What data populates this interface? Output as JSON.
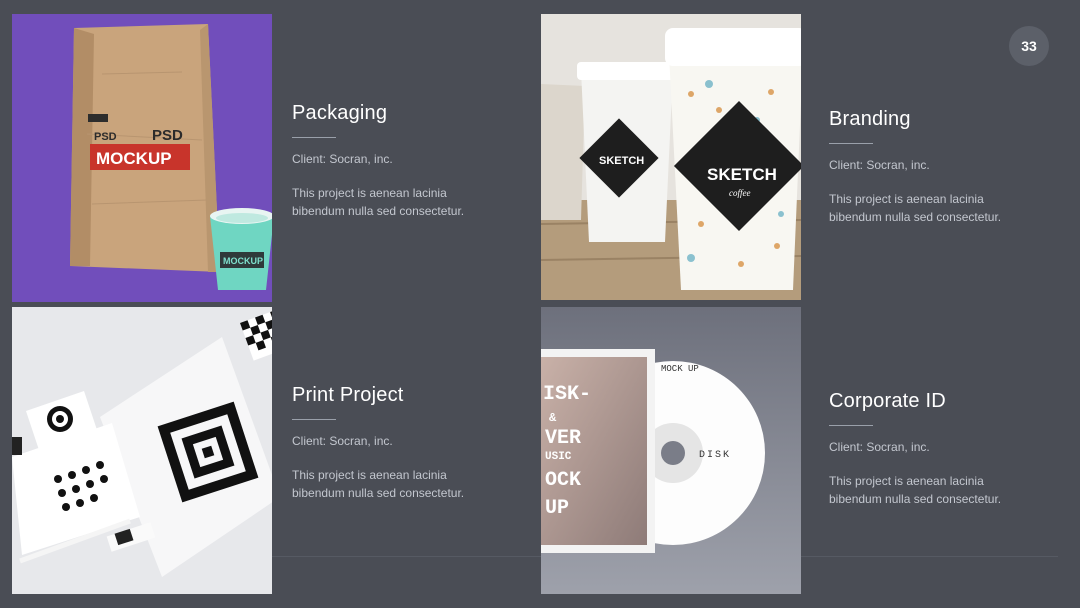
{
  "page_number": "33",
  "projects": [
    {
      "title": "Packaging",
      "client": "Client: Socran, inc.",
      "description": "This project is  aenean lacinia bibendum nulla sed consectetur.",
      "image_text": {
        "bag_line1": "PSD",
        "bag_line2": "MOCKUP",
        "cup_text": "MOCKUP"
      }
    },
    {
      "title": "Branding",
      "client": "Client: Socran, inc.",
      "description": "This project is  aenean lacinia bibendum nulla sed consectetur.",
      "image_text": {
        "cup_small": "SKETCH",
        "cup_large": "SKETCH",
        "cup_sub": "coffee"
      }
    },
    {
      "title": "Print Project",
      "client": "Client: Socran, inc.",
      "description": "This project is  aenean lacinia bibendum nulla sed consectetur."
    },
    {
      "title": "Corporate ID",
      "client": "Client: Socran, inc.",
      "description": "This project is  aenean lacinia bibendum nulla sed consectetur.",
      "image_text": {
        "cover_l1": "ISK-",
        "cover_l2": "&",
        "cover_l3": "VER",
        "cover_l4": "USIC",
        "cover_l5": "OCK",
        "cover_l6": "UP",
        "disc_label": "DISK",
        "disc_arc": "MOCK UP"
      }
    }
  ],
  "colors": {
    "background": "#4a4d55",
    "packaging_bg": "#6b48b6",
    "tag_red": "#c8342b"
  }
}
